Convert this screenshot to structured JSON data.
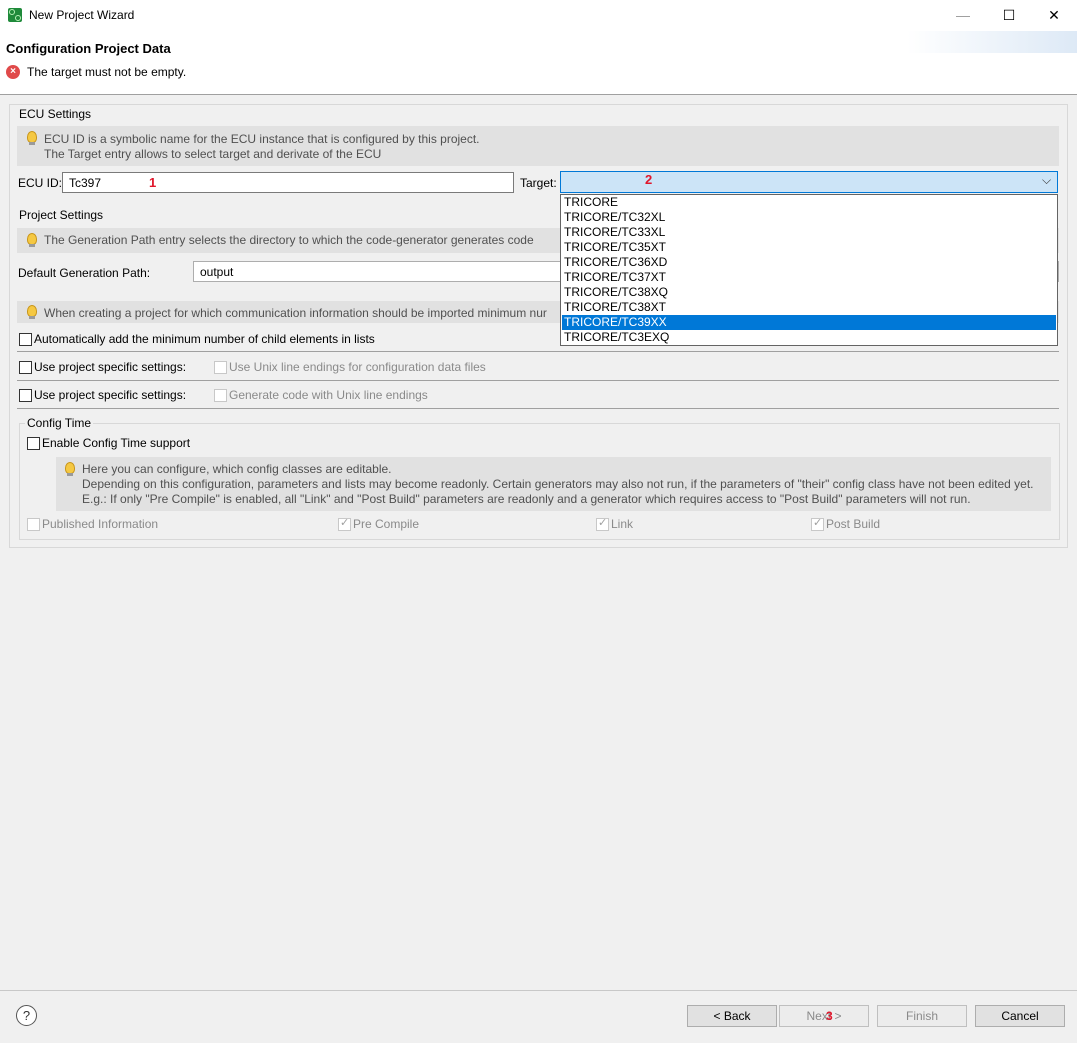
{
  "window": {
    "title": "New Project Wizard",
    "min": "—",
    "max": "☐",
    "close": "✕"
  },
  "header": {
    "title": "Configuration Project Data",
    "error": "The target must not be empty."
  },
  "ecu_settings": {
    "label": "ECU Settings",
    "hint_line1": "ECU ID is a symbolic name for the ECU instance that is configured by this project.",
    "hint_line2": "The Target entry allows to select target and derivate of the ECU",
    "ecu_id_label": "ECU ID:",
    "ecu_id_value": "Tc397",
    "marker1": "1",
    "target_label": "Target:",
    "target_value": "",
    "marker2": "2",
    "target_options": [
      "TRICORE",
      "TRICORE/TC32XL",
      "TRICORE/TC33XL",
      "TRICORE/TC35XT",
      "TRICORE/TC36XD",
      "TRICORE/TC37XT",
      "TRICORE/TC38XQ",
      "TRICORE/TC38XT",
      "TRICORE/TC39XX",
      "TRICORE/TC3EXQ"
    ],
    "selected_option": "TRICORE/TC39XX"
  },
  "project_settings": {
    "label": "Project Settings",
    "gen_hint": "The Generation Path entry selects the directory to which the code-generator generates code",
    "gen_path_label": "Default Generation Path:",
    "gen_path_value": "output",
    "import_hint": "When creating a project for which communication information should be imported minimum nur",
    "auto_add_label": "Automatically add the minimum number of child elements in lists",
    "specific1_label": "Use project specific settings:",
    "unix_config_label": "Use Unix line endings for configuration data files",
    "specific2_label": "Use project specific settings:",
    "unix_code_label": "Generate code with Unix line endings"
  },
  "config_time": {
    "label": "Config Time",
    "enable_label": "Enable Config Time support",
    "hint_line1": "Here you can configure, which config classes are editable.",
    "hint_line2": "Depending on this configuration, parameters and lists may become readonly. Certain generators may also not run, if the parameters of \"their\" config class have not been edited yet.",
    "hint_line3": "E.g.: If only \"Pre Compile\" is enabled, all \"Link\" and \"Post Build\" parameters are readonly and a generator which requires access to \"Post Build\" parameters will not run.",
    "published_label": "Published Information",
    "precompile_label": "Pre Compile",
    "link_label": "Link",
    "postbuild_label": "Post Build"
  },
  "footer": {
    "help": "?",
    "back": "< Back",
    "next": "Next >",
    "marker3": "3",
    "finish": "Finish",
    "cancel": "Cancel"
  }
}
